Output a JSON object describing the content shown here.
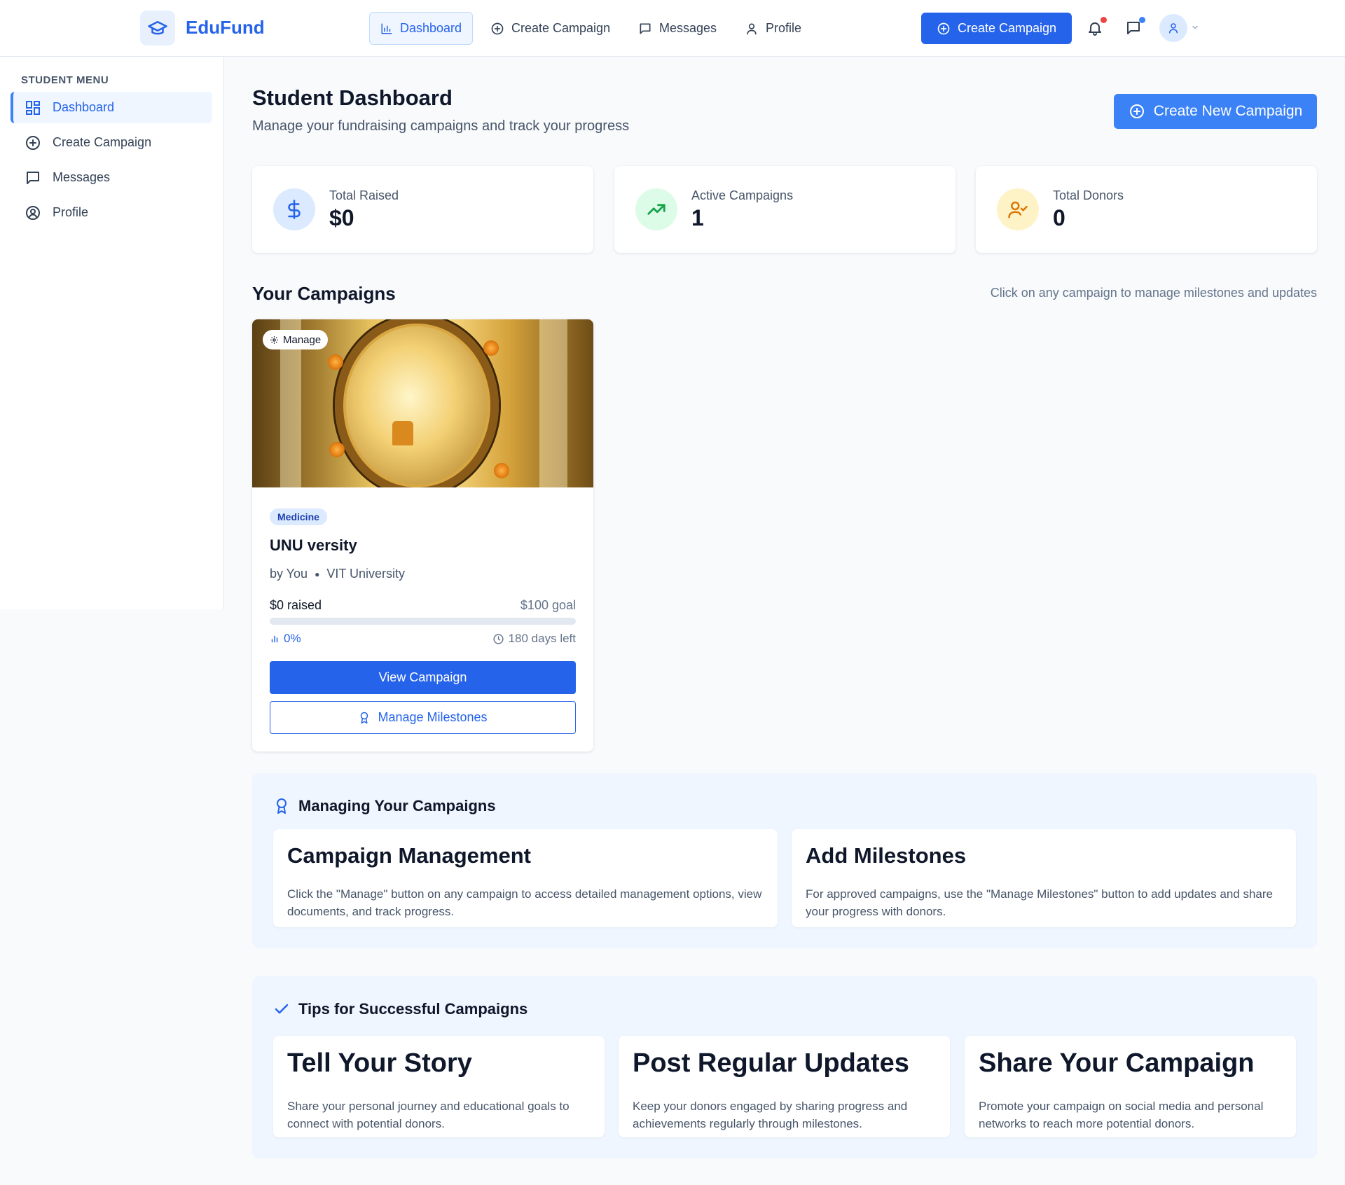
{
  "brand": {
    "name": "EduFund"
  },
  "topnav": {
    "items": [
      {
        "label": "Dashboard"
      },
      {
        "label": "Create Campaign"
      },
      {
        "label": "Messages"
      },
      {
        "label": "Profile"
      }
    ],
    "create_button": "Create Campaign"
  },
  "sidebar": {
    "heading": "STUDENT MENU",
    "items": [
      {
        "label": "Dashboard"
      },
      {
        "label": "Create Campaign"
      },
      {
        "label": "Messages"
      },
      {
        "label": "Profile"
      }
    ]
  },
  "header": {
    "title": "Student Dashboard",
    "subtitle": "Manage your fundraising campaigns and track your progress",
    "new_campaign_button": "Create New Campaign"
  },
  "stats": [
    {
      "label": "Total Raised",
      "value": "$0"
    },
    {
      "label": "Active Campaigns",
      "value": "1"
    },
    {
      "label": "Total Donors",
      "value": "0"
    }
  ],
  "campaigns_section": {
    "title": "Your Campaigns",
    "hint": "Click on any campaign to manage milestones and updates"
  },
  "campaign": {
    "manage_label": "Manage",
    "category": "Medicine",
    "title": "UNU versity",
    "author": "by You",
    "school": "VIT University",
    "raised": "$0 raised",
    "goal": "$100 goal",
    "percent": "0%",
    "progress_fraction": 0,
    "days_left": "180 days left",
    "view_button": "View Campaign",
    "milestones_button": "Manage Milestones"
  },
  "managing": {
    "title": "Managing Your Campaigns",
    "cards": [
      {
        "title": "Campaign Management",
        "text": "Click the \"Manage\" button on any campaign to access detailed management options, view documents, and track progress."
      },
      {
        "title": "Add Milestones",
        "text": "For approved campaigns, use the \"Manage Milestones\" button to add updates and share your progress with donors."
      }
    ]
  },
  "tips": {
    "title": "Tips for Successful Campaigns",
    "cards": [
      {
        "title": "Tell Your Story",
        "text": "Share your personal journey and educational goals to connect with potential donors."
      },
      {
        "title": "Post Regular Updates",
        "text": "Keep your donors engaged by sharing progress and achievements regularly through milestones."
      },
      {
        "title": "Share Your Campaign",
        "text": "Promote your campaign on social media and personal networks to reach more potential donors."
      }
    ]
  },
  "colors": {
    "primary": "#2563eb",
    "notification_dot": "#ef4444",
    "message_dot": "#3b82f6"
  }
}
